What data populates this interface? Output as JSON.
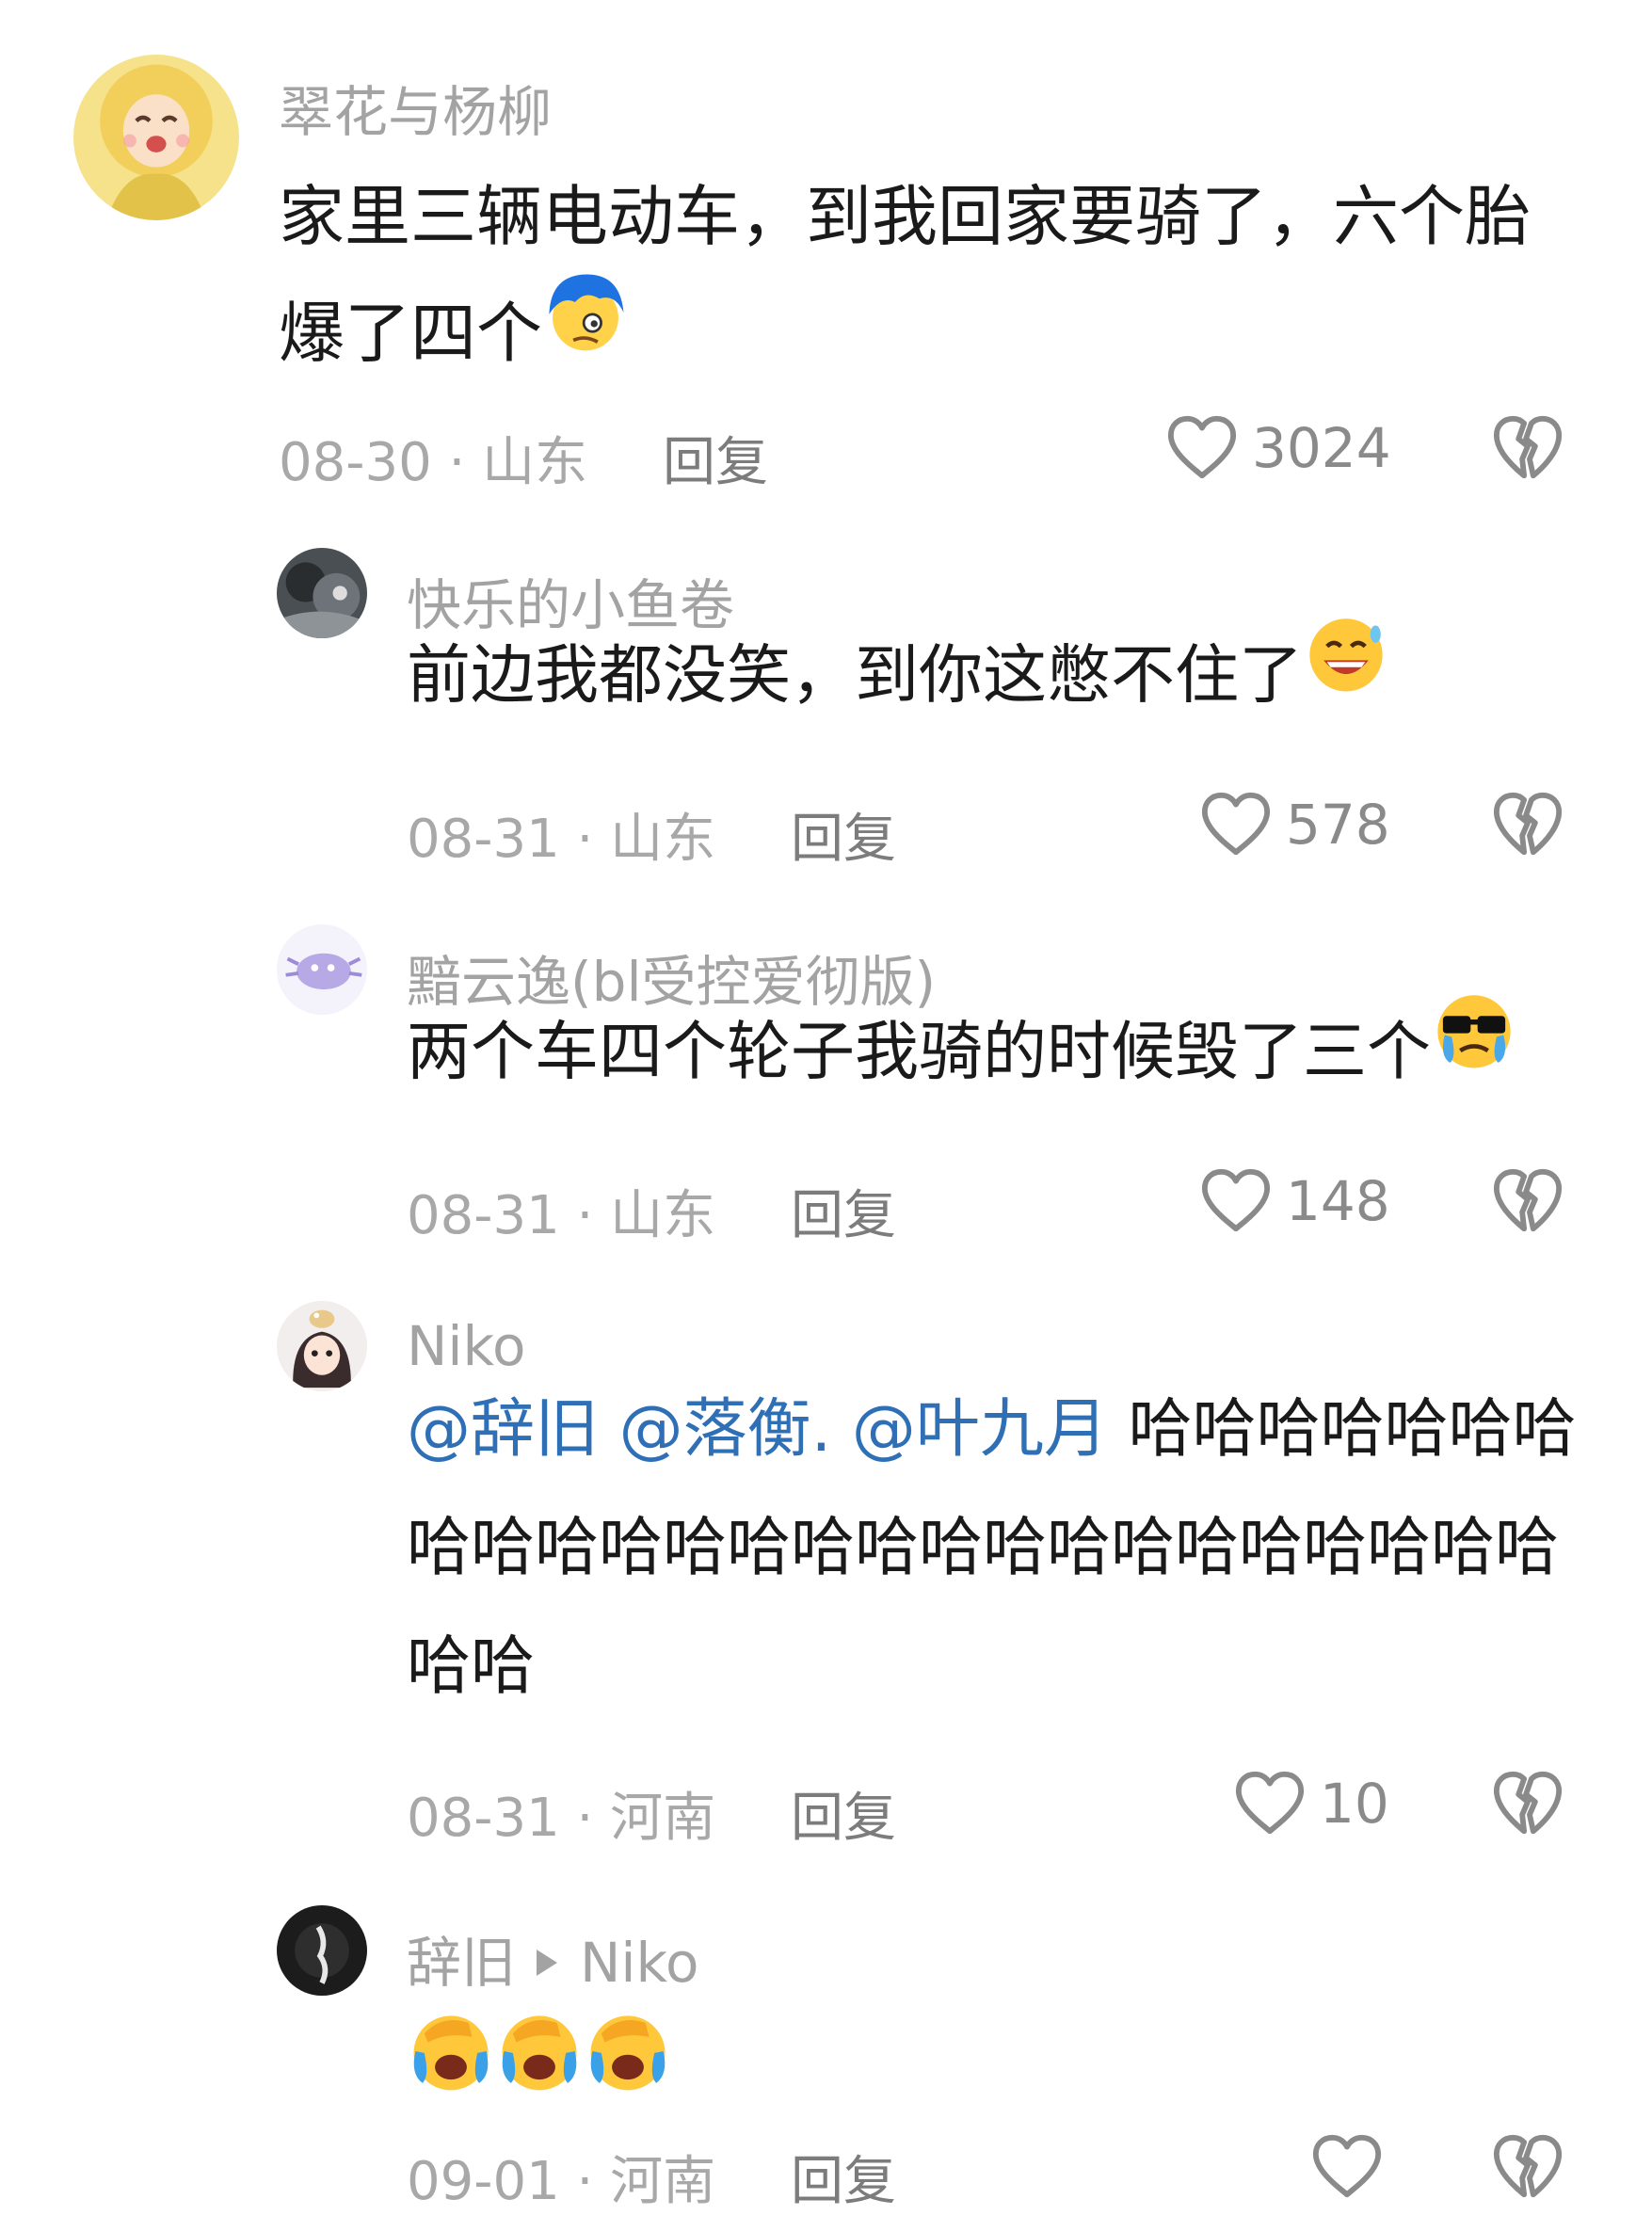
{
  "comments": [
    {
      "username": "翠花与杨柳",
      "text": "家里三辆电动车，到我回家要骑了，六个胎爆了四个",
      "text_line1": "家里三辆电动车，到我回家要骑了，六个胎",
      "text_line2": "爆了四个",
      "date_location": "08-30 · 山东",
      "reply_label": "回复",
      "likes": "3024",
      "emoji": "cry-hair-emoji"
    },
    {
      "username": "快乐的小鱼卷",
      "text": "前边我都没笑，到你这憋不住了",
      "date_location": "08-31 · 山东",
      "reply_label": "回复",
      "likes": "578",
      "emoji": "grin-sweat-emoji"
    },
    {
      "username": "黯云逸(bl受控爱彻版)",
      "text": "两个车四个轮子我骑的时候毁了三个",
      "date_location": "08-31 · 山东",
      "reply_label": "回复",
      "likes": "148",
      "emoji": "sunglasses-cry-emoji"
    },
    {
      "username": "Niko",
      "mentions": [
        "@辞旧",
        "@落衡.",
        "@叶九月"
      ],
      "text_line1_tail": "哈哈哈哈哈哈哈",
      "text_line2": "哈哈哈哈哈哈哈哈哈哈哈哈哈哈哈哈哈哈",
      "text_line3": "哈哈",
      "date_location": "08-31 · 河南",
      "reply_label": "回复",
      "likes": "10"
    },
    {
      "username": "辞旧",
      "reply_to": "Niko",
      "date_location": "09-01 · 河南",
      "reply_label": "回复",
      "likes": "",
      "emoji": "face-palm-cry-emoji"
    }
  ],
  "colors": {
    "username": "#a3a3a3",
    "text": "#1a1a1a",
    "mention": "#2f6fb6",
    "meta": "#a8a8a8"
  }
}
